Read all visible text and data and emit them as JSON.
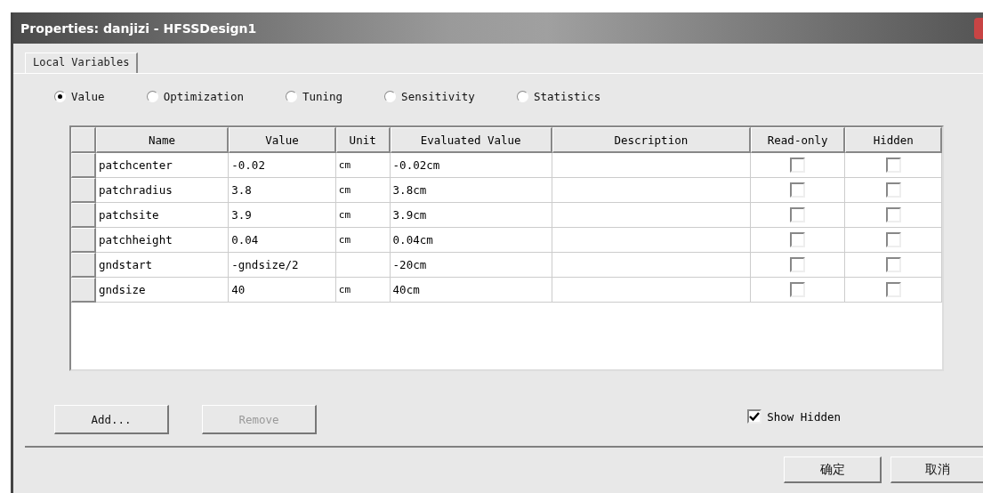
{
  "window": {
    "title": "Properties: danjizi - HFSSDesign1"
  },
  "tabs": [
    {
      "label": "Local Variables",
      "selected": true
    }
  ],
  "modes": [
    {
      "label": "Value",
      "selected": true
    },
    {
      "label": "Optimization",
      "selected": false
    },
    {
      "label": "Tuning",
      "selected": false
    },
    {
      "label": "Sensitivity",
      "selected": false
    },
    {
      "label": "Statistics",
      "selected": false
    }
  ],
  "table": {
    "columns": [
      "Name",
      "Value",
      "Unit",
      "Evaluated Value",
      "Description",
      "Read-only",
      "Hidden"
    ],
    "rows": [
      {
        "name": "patchcenter",
        "value": "-0.02",
        "unit": "cm",
        "evaluated": "-0.02cm",
        "read_only": false,
        "hidden": false
      },
      {
        "name": "patchradius",
        "value": "3.8",
        "unit": "cm",
        "evaluated": "3.8cm",
        "read_only": false,
        "hidden": false
      },
      {
        "name": "patchsite",
        "value": "3.9",
        "unit": "cm",
        "evaluated": "3.9cm",
        "read_only": false,
        "hidden": false
      },
      {
        "name": "patchheight",
        "value": "0.04",
        "unit": "cm",
        "evaluated": "0.04cm",
        "read_only": false,
        "hidden": false
      },
      {
        "name": "gndstart",
        "value": "-gndsize/2",
        "evaluated": "-20cm",
        "read_only": false,
        "hidden": false
      },
      {
        "name": "gndsize",
        "value": "40",
        "unit": "cm",
        "evaluated": "40cm",
        "read_only": false,
        "hidden": false
      }
    ]
  },
  "buttons": [
    {
      "label": "Add...",
      "disabled": false
    },
    {
      "label": "Remove",
      "disabled": true
    }
  ],
  "show_hidden": {
    "label": "Show Hidden",
    "checked": true
  },
  "dialog_buttons": [
    "确定",
    "取消"
  ]
}
